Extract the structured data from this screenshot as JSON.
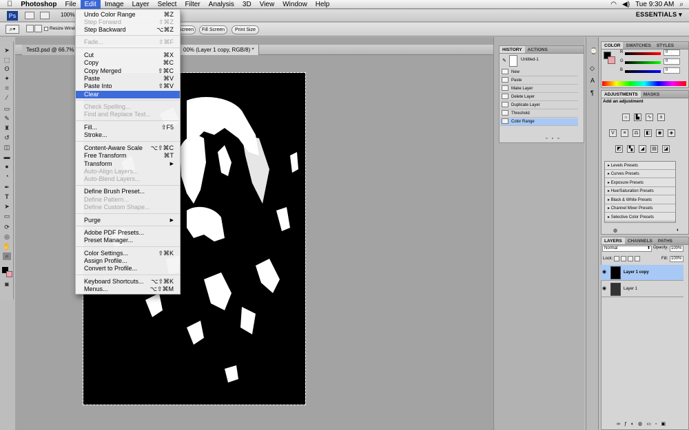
{
  "menubar": {
    "apple": "",
    "app": "Photoshop",
    "items": [
      "File",
      "Edit",
      "Image",
      "Layer",
      "Select",
      "Filter",
      "Analysis",
      "3D",
      "View",
      "Window",
      "Help"
    ],
    "active": "Edit",
    "clock": "Tue 9:30 AM"
  },
  "appbar": {
    "zoom": "100%",
    "workspace": "ESSENTIALS ▾"
  },
  "options": {
    "resize_windows": "Resize Window",
    "buttons": [
      "Screen",
      "Fill Screen",
      "Print Size"
    ]
  },
  "document": {
    "tab1": "Test3.psd @ 66.7% (La",
    "tab2": "copy, RGB/8) *",
    "tab2_prefix": "00% (Layer 1 copy, RGB/8) *"
  },
  "edit_menu": [
    {
      "label": "Undo Color Range",
      "shortcut": "⌘Z",
      "state": "normal"
    },
    {
      "label": "Step Forward",
      "shortcut": "⇧⌘Z",
      "state": "disabled"
    },
    {
      "label": "Step Backward",
      "shortcut": "⌥⌘Z",
      "state": "normal"
    },
    {
      "label": "Fade...",
      "shortcut": "⇧⌘F",
      "state": "disabled"
    },
    {
      "label": "Cut",
      "shortcut": "⌘X",
      "state": "normal"
    },
    {
      "label": "Copy",
      "shortcut": "⌘C",
      "state": "normal"
    },
    {
      "label": "Copy Merged",
      "shortcut": "⇧⌘C",
      "state": "normal"
    },
    {
      "label": "Paste",
      "shortcut": "⌘V",
      "state": "normal"
    },
    {
      "label": "Paste Into",
      "shortcut": "⇧⌘V",
      "state": "normal"
    },
    {
      "label": "Clear",
      "shortcut": "",
      "state": "selected"
    },
    {
      "label": "Check Spelling...",
      "shortcut": "",
      "state": "disabled"
    },
    {
      "label": "Find and Replace Text...",
      "shortcut": "",
      "state": "disabled"
    },
    {
      "label": "Fill...",
      "shortcut": "⇧F5",
      "state": "normal"
    },
    {
      "label": "Stroke...",
      "shortcut": "",
      "state": "normal"
    },
    {
      "label": "Content-Aware Scale",
      "shortcut": "⌥⇧⌘C",
      "state": "normal"
    },
    {
      "label": "Free Transform",
      "shortcut": "⌘T",
      "state": "normal"
    },
    {
      "label": "Transform",
      "shortcut": "▶",
      "state": "normal"
    },
    {
      "label": "Auto-Align Layers...",
      "shortcut": "",
      "state": "disabled"
    },
    {
      "label": "Auto-Blend Layers...",
      "shortcut": "",
      "state": "disabled"
    },
    {
      "label": "Define Brush Preset...",
      "shortcut": "",
      "state": "normal"
    },
    {
      "label": "Define Pattern...",
      "shortcut": "",
      "state": "disabled"
    },
    {
      "label": "Define Custom Shape...",
      "shortcut": "",
      "state": "disabled"
    },
    {
      "label": "Purge",
      "shortcut": "▶",
      "state": "normal"
    },
    {
      "label": "Adobe PDF Presets...",
      "shortcut": "",
      "state": "normal"
    },
    {
      "label": "Preset Manager...",
      "shortcut": "",
      "state": "normal"
    },
    {
      "label": "Color Settings...",
      "shortcut": "⇧⌘K",
      "state": "normal"
    },
    {
      "label": "Assign Profile...",
      "shortcut": "",
      "state": "normal"
    },
    {
      "label": "Convert to Profile...",
      "shortcut": "",
      "state": "normal"
    },
    {
      "label": "Keyboard Shortcuts...",
      "shortcut": "⌥⇧⌘K",
      "state": "normal"
    },
    {
      "label": "Menus...",
      "shortcut": "⌥⇧⌘M",
      "state": "normal"
    }
  ],
  "history": {
    "tabs": [
      "HISTORY",
      "ACTIONS"
    ],
    "snapshot": "Untitled-1",
    "steps": [
      "New",
      "Paste",
      "Make Layer",
      "Delete Layer",
      "Duplicate Layer",
      "Threshold",
      "Color Range"
    ],
    "selected": "Color Range"
  },
  "color": {
    "tabs": [
      "COLOR",
      "SWATCHES",
      "STYLES"
    ],
    "r_label": "R",
    "g_label": "G",
    "b_label": "B",
    "r": "0",
    "g": "0",
    "b": "0"
  },
  "adjustments": {
    "tabs": [
      "ADJUSTMENTS",
      "MASKS"
    ],
    "title": "Add an adjustment",
    "presets": [
      "Levels Presets",
      "Curves Presets",
      "Exposure Presets",
      "Hue/Saturation Presets",
      "Black & White Presets",
      "Channel Mixer Presets",
      "Selective Color Presets"
    ]
  },
  "layers": {
    "tabs": [
      "LAYERS",
      "CHANNELS",
      "PATHS"
    ],
    "blend": "Normal",
    "opacity_label": "Opacity:",
    "opacity": "100%",
    "lock_label": "Lock:",
    "fill_label": "Fill:",
    "fill": "100%",
    "items": [
      "Layer 1 copy",
      "Layer 1"
    ],
    "selected": "Layer 1 copy"
  }
}
